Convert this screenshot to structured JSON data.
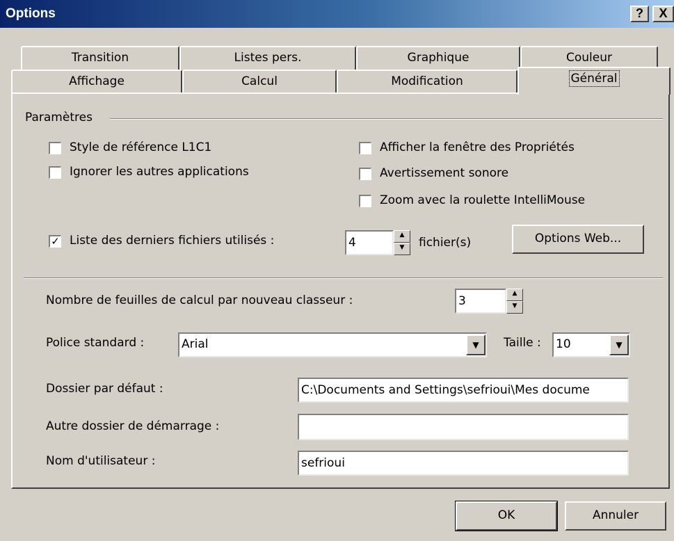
{
  "window": {
    "title": "Options",
    "help_btn": "?",
    "close_btn": "X"
  },
  "tabs_back": [
    "Transition",
    "Listes pers.",
    "Graphique",
    "Couleur"
  ],
  "tabs_front": [
    "Affichage",
    "Calcul",
    "Modification",
    "Général"
  ],
  "active_tab": "Général",
  "params": {
    "group_label": "Paramètres",
    "style_ref": {
      "label": "Style de référence L1C1",
      "checked": false
    },
    "ignore_apps": {
      "label": "Ignorer les autres applications",
      "checked": false
    },
    "show_props": {
      "label": "Afficher la fenêtre des Propriétés",
      "checked": false
    },
    "beep": {
      "label": "Avertissement sonore",
      "checked": false
    },
    "zoom_mouse": {
      "label": "Zoom avec la roulette IntelliMouse",
      "checked": false
    },
    "recent_files": {
      "label": "Liste des derniers fichiers utilisés :",
      "checked": true,
      "check_glyph": "✓",
      "value": "4",
      "unit": "fichier(s)"
    },
    "web_options_btn": "Options Web..."
  },
  "sheets": {
    "label": "Nombre de feuilles de calcul par nouveau classeur :",
    "value": "3"
  },
  "font": {
    "label": "Police standard :",
    "value": "Arial",
    "size_label": "Taille :",
    "size_value": "10"
  },
  "default_folder": {
    "label": "Dossier par défaut :",
    "value": "C:\\Documents and Settings\\sefrioui\\Mes docume"
  },
  "startup_folder": {
    "label": "Autre dossier de démarrage :",
    "value": ""
  },
  "user_name": {
    "label": "Nom d'utilisateur :",
    "value": "sefrioui"
  },
  "buttons": {
    "ok": "OK",
    "cancel": "Annuler"
  },
  "colors": {
    "face": "#d4d0c8",
    "title_start": "#0a246a",
    "title_end": "#a6caf0"
  }
}
